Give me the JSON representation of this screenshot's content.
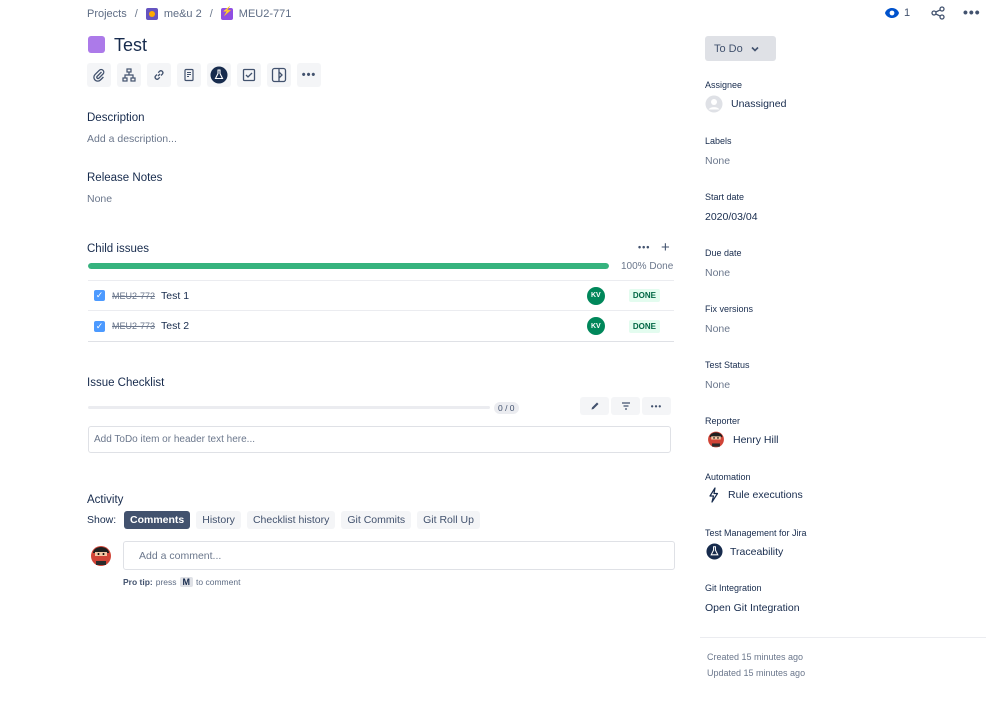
{
  "breadcrumb": {
    "projects": "Projects",
    "project": "me&u 2",
    "issue_key": "MEU2-771"
  },
  "header": {
    "watch_count": "1"
  },
  "issue": {
    "title": "Test"
  },
  "description": {
    "heading": "Description",
    "placeholder": "Add a description..."
  },
  "release_notes": {
    "heading": "Release Notes",
    "value": "None"
  },
  "child_issues": {
    "heading": "Child issues",
    "progress_label": "100% Done",
    "progress_fraction": 1.0,
    "items": [
      {
        "key": "MEU2-772",
        "summary": "Test 1",
        "assignee_initials": "KV",
        "status": "DONE"
      },
      {
        "key": "MEU2-773",
        "summary": "Test 2",
        "assignee_initials": "KV",
        "status": "DONE"
      }
    ]
  },
  "checklist": {
    "heading": "Issue Checklist",
    "count": "0 / 0",
    "input_placeholder": "Add ToDo item or header text here..."
  },
  "activity": {
    "heading": "Activity",
    "show_label": "Show:",
    "tabs": [
      "Comments",
      "History",
      "Checklist history",
      "Git Commits",
      "Git Roll Up"
    ],
    "selected_tab": "Comments",
    "comment_placeholder": "Add a comment...",
    "pro_tip_prefix": "Pro tip:",
    "pro_tip_press": "press",
    "pro_tip_key": "M",
    "pro_tip_suffix": "to comment"
  },
  "sidebar": {
    "status_button": "To Do",
    "assignee_label": "Assignee",
    "assignee_value": "Unassigned",
    "labels_label": "Labels",
    "labels_value": "None",
    "start_date_label": "Start date",
    "start_date_value": "2020/03/04",
    "due_date_label": "Due date",
    "due_date_value": "None",
    "fix_versions_label": "Fix versions",
    "fix_versions_value": "None",
    "test_status_label": "Test Status",
    "test_status_value": "None",
    "reporter_label": "Reporter",
    "reporter_value": "Henry Hill",
    "automation_label": "Automation",
    "automation_value": "Rule executions",
    "test_mgmt_label": "Test Management for Jira",
    "test_mgmt_value": "Traceability",
    "git_label": "Git Integration",
    "git_value": "Open Git Integration",
    "created": "Created 15 minutes ago",
    "updated": "Updated 15 minutes ago"
  },
  "colors": {
    "progress": "#36b37e",
    "done_lozenge": "#006644",
    "epic": "#904ee2",
    "selected_tab": "#42526e"
  }
}
